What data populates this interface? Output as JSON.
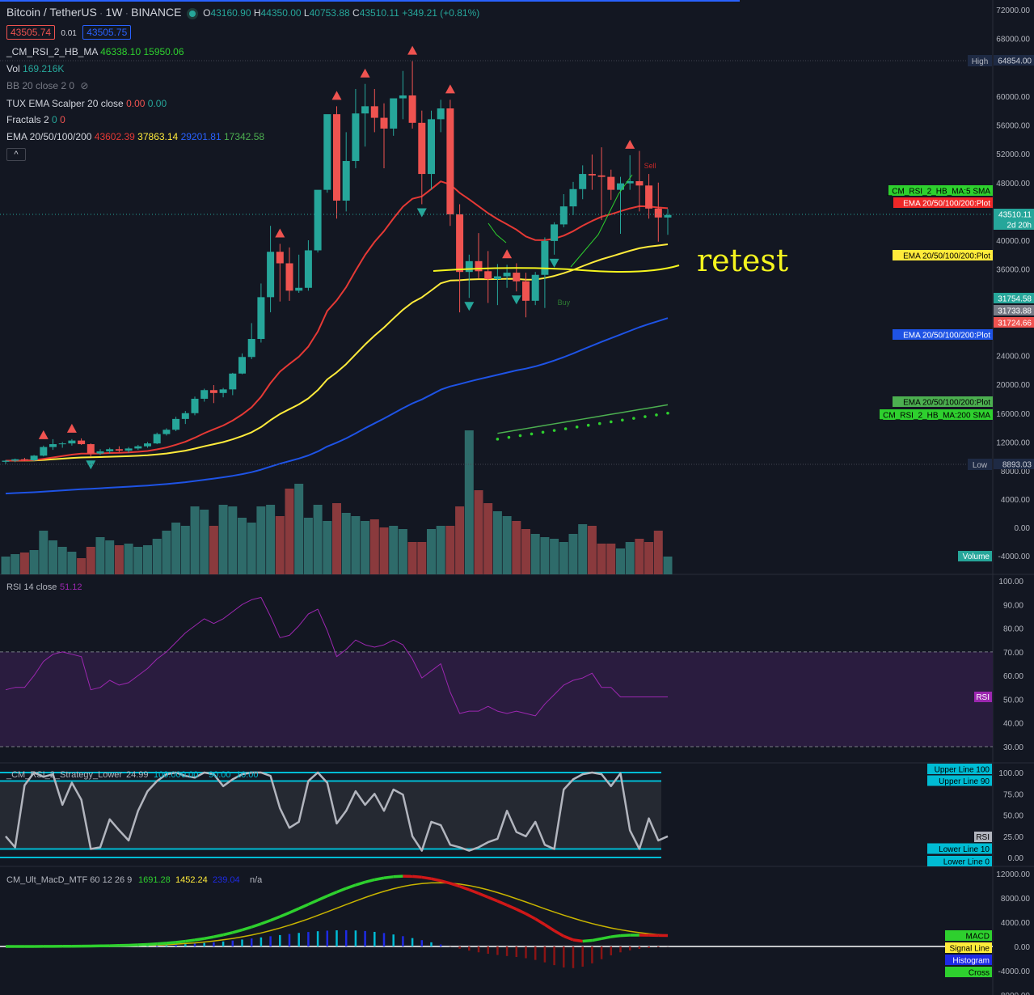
{
  "header": {
    "symbol": "Bitcoin / TetherUS",
    "interval": "1W",
    "exchange": "BINANCE",
    "ohlc": {
      "open_label": "O",
      "open": "43160.90",
      "high_label": "H",
      "high": "44350.00",
      "low_label": "L",
      "low": "40753.88",
      "close_label": "C",
      "close": "43510.11",
      "change": "+349.21 (+0.81%)"
    },
    "bid": "43505.74",
    "spread": "0.01",
    "ask": "43505.75"
  },
  "indicators": {
    "cm_rsi_ma": {
      "name": "_CM_RSI_2_HB_MA",
      "v1": "46338.10",
      "v2": "15950.06"
    },
    "vol": {
      "name": "Vol",
      "v1": "169.216K"
    },
    "bb": {
      "name": "BB 20 close 2 0"
    },
    "tux": {
      "name": "TUX EMA Scalper 20 close",
      "v1": "0.00",
      "v2": "0.00"
    },
    "fractals": {
      "name": "Fractals 2",
      "v1": "0",
      "v2": "0"
    },
    "ema": {
      "name": "EMA 20/50/100/200",
      "v1": "43602.39",
      "v2": "37863.14",
      "v3": "29201.81",
      "v4": "17342.58"
    },
    "collapse_glyph": "^"
  },
  "colors": {
    "bg": "#131722",
    "up": "#26a69a",
    "down": "#ef5350",
    "ema20": "#e53935",
    "ema50": "#ffeb3b",
    "ema100": "#1e53e5",
    "ema200": "#4caf50",
    "rsi": "#9c27b0",
    "rsi_band": "#2a1c3f",
    "stoch": "#b2b5be",
    "stoch_lines": "#00bcd4",
    "macd": "#2ed02e",
    "signal": "#c8b400",
    "macd_red": "#d01818"
  },
  "annotation": "retest",
  "chart_data": [
    {
      "type": "candlestick",
      "x_unit": "weekly candle index (oldest to newest)",
      "candles": [
        [
          9250,
          9500,
          8950,
          9400
        ],
        [
          9400,
          9700,
          9200,
          9600
        ],
        [
          9600,
          9800,
          9300,
          9450
        ],
        [
          9450,
          10200,
          9350,
          10100
        ],
        [
          10100,
          11500,
          10000,
          11300
        ],
        [
          11300,
          12400,
          10900,
          11700
        ],
        [
          11700,
          12000,
          11200,
          11800
        ],
        [
          11800,
          12400,
          11500,
          12200
        ],
        [
          12200,
          12500,
          11600,
          11700
        ],
        [
          11700,
          11800,
          10000,
          10400
        ],
        [
          10400,
          11000,
          10200,
          10700
        ],
        [
          10700,
          11200,
          10400,
          11000
        ],
        [
          11000,
          11400,
          10600,
          10800
        ],
        [
          10800,
          11300,
          10500,
          11100
        ],
        [
          11100,
          11600,
          10900,
          11400
        ],
        [
          11400,
          12000,
          11200,
          11800
        ],
        [
          11800,
          13300,
          11700,
          13100
        ],
        [
          13100,
          13900,
          12900,
          13700
        ],
        [
          13700,
          15500,
          13500,
          15200
        ],
        [
          15200,
          16300,
          14500,
          16000
        ],
        [
          16000,
          18300,
          15700,
          18000
        ],
        [
          18000,
          19400,
          17600,
          19200
        ],
        [
          19200,
          19900,
          17400,
          18800
        ],
        [
          18800,
          19500,
          18200,
          19300
        ],
        [
          19300,
          21600,
          18500,
          21500
        ],
        [
          21500,
          24300,
          21400,
          23800
        ],
        [
          23800,
          28500,
          23500,
          26300
        ],
        [
          26300,
          34000,
          25800,
          32100
        ],
        [
          32100,
          42000,
          30000,
          38400
        ],
        [
          38400,
          39500,
          31500,
          36800
        ],
        [
          36800,
          39000,
          31600,
          33000
        ],
        [
          33000,
          38000,
          32700,
          33400
        ],
        [
          33400,
          40000,
          33000,
          38600
        ],
        [
          38600,
          44000,
          38300,
          47000
        ],
        [
          47000,
          57000,
          46600,
          57500
        ],
        [
          57500,
          58600,
          43000,
          45500
        ],
        [
          45500,
          55000,
          44000,
          51000
        ],
        [
          51000,
          61000,
          50000,
          57600
        ],
        [
          57600,
          61700,
          53000,
          58600
        ],
        [
          58600,
          61000,
          55000,
          57000
        ],
        [
          57000,
          59000,
          50000,
          55500
        ],
        [
          55500,
          59300,
          54500,
          59700
        ],
        [
          59700,
          63500,
          56800,
          60100
        ],
        [
          60100,
          64854,
          55500,
          56300
        ],
        [
          56300,
          58000,
          45000,
          49200
        ],
        [
          49200,
          58000,
          47000,
          56800
        ],
        [
          56800,
          59500,
          55000,
          58300
        ],
        [
          58300,
          59500,
          42000,
          43600
        ],
        [
          43600,
          45000,
          30000,
          35600
        ],
        [
          35600,
          38000,
          32000,
          37100
        ],
        [
          37100,
          41000,
          34700,
          35700
        ],
        [
          35700,
          38500,
          31300,
          34600
        ],
        [
          34600,
          36700,
          31000,
          35000
        ],
        [
          35000,
          36600,
          33400,
          35500
        ],
        [
          35500,
          36800,
          32900,
          34300
        ],
        [
          34300,
          35500,
          29300,
          31600
        ],
        [
          31600,
          35600,
          31000,
          35200
        ],
        [
          35200,
          40400,
          30600,
          39900
        ],
        [
          39900,
          42500,
          38000,
          42200
        ],
        [
          42200,
          46400,
          41800,
          44700
        ],
        [
          44700,
          48100,
          43500,
          47100
        ],
        [
          47100,
          50400,
          45700,
          49200
        ],
        [
          49200,
          51900,
          47000,
          49000
        ],
        [
          49000,
          52900,
          42800,
          48800
        ],
        [
          48800,
          49800,
          45600,
          47000
        ],
        [
          47000,
          48800,
          40900,
          47900
        ],
        [
          47900,
          51800,
          47000,
          48200
        ],
        [
          48200,
          52400,
          44000,
          47600
        ],
        [
          47600,
          49200,
          43000,
          44400
        ],
        [
          44400,
          48000,
          39800,
          43160
        ],
        [
          43160,
          44350,
          40753,
          43510
        ]
      ],
      "ema": {
        "period": [
          20,
          50,
          100,
          200
        ],
        "last_values": [
          43602.39,
          37863.14,
          29201.81,
          17342.58
        ]
      },
      "y_ticks": [
        "72000.00",
        "68000.00",
        "60000.00",
        "56000.00",
        "52000.00",
        "48000.00",
        "40000.00",
        "36000.00",
        "24000.00",
        "20000.00",
        "16000.00",
        "12000.00",
        "8000.00",
        "4000.00",
        "0.00",
        "-4000.00"
      ],
      "markers": {
        "buy": "Buy",
        "sell": "Sell",
        "high_label": "High",
        "high_value": "64854.00",
        "low_label": "Low",
        "low_value": "8893.03"
      },
      "price_tags": [
        "43510.11",
        "2d 20h",
        "31754.58",
        "31733.88",
        "31724.66"
      ],
      "legend_tags": [
        "_CM_RSI_2_HB_MA:5 SMA",
        "EMA 20/50/100/200:Plot",
        "EMA 20/50/100/200:Plot",
        "EMA 20/50/100/200:Plot",
        "EMA 20/50/100/200:Plot",
        "_CM_RSI_2_HB_MA:200 SMA"
      ],
      "volume_label": "Volume"
    },
    {
      "type": "line",
      "title": "RSI 14 close",
      "last": "51.12",
      "tag": "RSI",
      "ylim": [
        25,
        100
      ],
      "bands": [
        30,
        70
      ],
      "y_ticks": [
        "100.00",
        "90.00",
        "80.00",
        "70.00",
        "60.00",
        "50.00",
        "40.00",
        "30.00"
      ],
      "values": [
        54,
        55,
        55,
        60,
        66,
        69,
        70,
        69,
        68,
        54,
        55,
        58,
        56,
        57,
        60,
        63,
        67,
        70,
        74,
        78,
        81,
        84,
        82,
        84,
        87,
        90,
        92,
        93,
        85,
        76,
        77,
        81,
        86,
        88,
        79,
        68,
        71,
        75,
        73,
        72,
        73,
        75,
        73,
        67,
        59,
        62,
        65,
        53,
        44,
        45,
        45,
        47,
        45,
        44,
        45,
        44,
        43,
        48,
        52,
        56,
        58,
        59,
        61,
        55,
        55,
        51,
        51,
        51,
        51,
        51,
        51
      ]
    },
    {
      "type": "line",
      "title": "_CM_RSI_2_Strategy_Lower",
      "values_label": [
        "24.99",
        "100.00",
        "0.00",
        "90.00",
        "10.00"
      ],
      "tag": "RSI",
      "ylim": [
        0,
        100
      ],
      "y_ticks": [
        "100.00",
        "75.00",
        "50.00",
        "25.00",
        "0.00"
      ],
      "lines": [
        "Upper Line 100",
        "Upper Line 90",
        "Lower Line 10",
        "Lower Line 0"
      ],
      "values": [
        25,
        12,
        85,
        100,
        95,
        98,
        62,
        88,
        68,
        10,
        12,
        45,
        32,
        20,
        55,
        78,
        90,
        98,
        100,
        96,
        94,
        100,
        98,
        84,
        92,
        98,
        100,
        100,
        96,
        58,
        35,
        42,
        90,
        100,
        88,
        40,
        55,
        78,
        62,
        75,
        55,
        80,
        74,
        25,
        8,
        42,
        38,
        15,
        12,
        8,
        12,
        18,
        22,
        55,
        30,
        25,
        42,
        15,
        10,
        80,
        92,
        98,
        100,
        98,
        84,
        99,
        32,
        10,
        46,
        20,
        25
      ]
    },
    {
      "type": "line",
      "title": "CM_Ult_MacD_MTF 60 12 26 9",
      "values_label": [
        "1691.28",
        "1452.24",
        "239.04",
        "n/a"
      ],
      "ylim": [
        -8000,
        12000
      ],
      "y_ticks": [
        "12000.00",
        "8000.00",
        "4000.00",
        "0.00",
        "-4000.00",
        "-8000.00"
      ],
      "legend": [
        "MACD",
        "Signal Line",
        "Histogram",
        "Cross"
      ]
    }
  ]
}
